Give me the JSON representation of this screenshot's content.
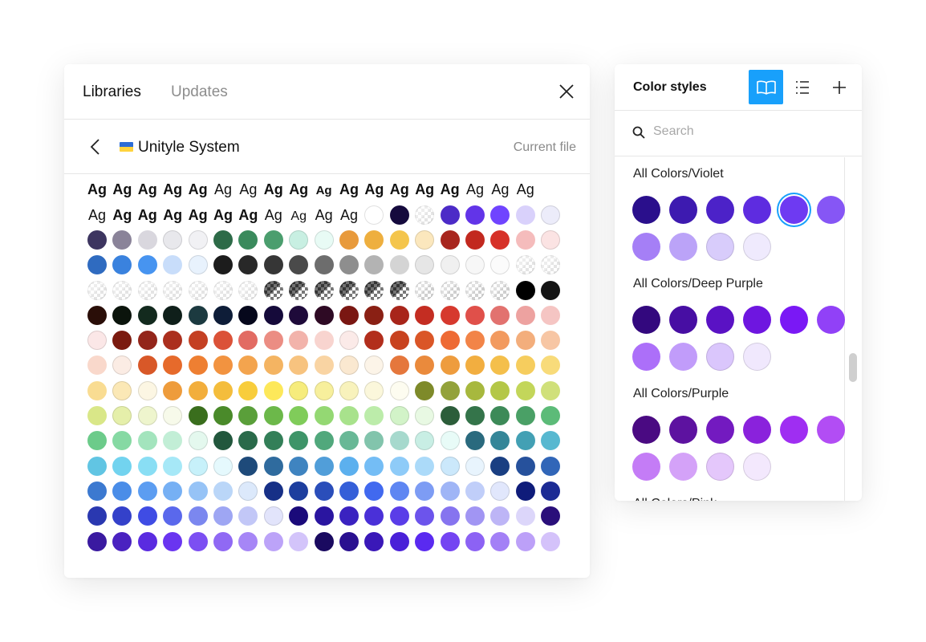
{
  "libraries_panel": {
    "tabs": [
      "Libraries",
      "Updates"
    ],
    "library_name": "Unityle System",
    "current_file_label": "Current file",
    "flag_colors": [
      "#2c6cd6",
      "#ffd33d"
    ],
    "type_sample_text": "Ag",
    "grid_rows": [
      [
        "Ag:b",
        "Ag:b",
        "Ag:b",
        "Ag:b",
        "Ag:b",
        "Ag:m",
        "Ag:m",
        "Ag:r",
        "Ag:r",
        "Ag:r",
        "Ag:b",
        "Ag:b",
        "Ag:b",
        "Ag:b",
        "Ag:r",
        "Ag:r",
        "Ag:b",
        "Ag:b"
      ],
      [
        "Ag:b",
        "Ag:b",
        "Ag:b",
        "Ag:b",
        "Ag:b",
        "Ag:r",
        "Ag:r",
        "Ag:b",
        "Ag:b",
        "Ag:bs",
        "Ag:b",
        "Ag:b",
        "Ag:b",
        "Ag:b",
        "Ag:b",
        "Ag:r",
        "Ag:r",
        "Ag:r"
      ],
      [
        "Ag:r",
        "Ag:b",
        "Ag:b",
        "Ag:b",
        "Ag:b",
        "Ag:b",
        "Ag:b",
        "Ag:r",
        "Ag:rs",
        "Ag:r",
        "Ag:r",
        "#ffffff",
        "#150a3d",
        "chk",
        "#4c2bc7",
        "#6234e8",
        "#7044ff",
        "#d9d1fb",
        "#ececfa"
      ],
      [
        "#3d3560",
        "#8a8399",
        "#d9d7de",
        "#e8e8ec",
        "#f1f1f4",
        "#2d6b48",
        "#3a8a5c",
        "#4b9e6e",
        "#c8efe2",
        "#e8fbf5",
        "#e89a3c",
        "#eeaf3f",
        "#f4c54c",
        "#fbe7bd",
        "#a8261e",
        "#c2291f",
        "#d63128",
        "#f5bcbc",
        "#fbe3e3"
      ],
      [
        "#2f6bc0",
        "#3a82de",
        "#4794f0",
        "#c8ddfa",
        "#e8f2fd",
        "#1c1c1c",
        "#282828",
        "#363636",
        "#4a4a4a",
        "#6d6d6d",
        "#8e8e8e",
        "#b3b3b3",
        "#d4d4d4",
        "#e6e6e6",
        "#f0f0f0",
        "#f7f7f7",
        "#fbfbfb",
        "chk",
        "chk"
      ],
      [
        "chk",
        "chk",
        "chk",
        "chk",
        "chk",
        "chk",
        "chk",
        "chkd",
        "chkd",
        "chkd",
        "chkd",
        "chkd",
        "chkd",
        "chkl",
        "chkl",
        "chkl",
        "chkl",
        "#000000",
        "#141414"
      ],
      [
        "#2a0e08",
        "#0b140c",
        "#132a1e",
        "#0f1f1a",
        "#1c3a40",
        "#0e1d38",
        "#06081c",
        "#150a3a",
        "#1e0a3a",
        "#2e0a24",
        "#7a1712",
        "#8a2014",
        "#a8251a",
        "#c42d22",
        "#d6392e",
        "#e0504a",
        "#e2726f",
        "#eda2a0",
        "#f5c5c3"
      ],
      [
        "#fbe7e7",
        "#7b1a0f",
        "#93251a",
        "#ab2f1e",
        "#c44023",
        "#db5238",
        "#e26b63",
        "#eb8d83",
        "#f2b3ab",
        "#f8d4cf",
        "#fbeae8",
        "#b22e1c",
        "#c8421e",
        "#da5627",
        "#ee6a34",
        "#f28448",
        "#f29a5f",
        "#f3ae7c",
        "#f7c6a4"
      ],
      [
        "#f9d8cb",
        "#fbece4",
        "#d85828",
        "#e66a2b",
        "#ee7f32",
        "#f29340",
        "#f3a44e",
        "#f4b462",
        "#f7c37f",
        "#f9d4a3",
        "#fae8d0",
        "#fcf4e8",
        "#e5773c",
        "#ea8a3c",
        "#ee9c3e",
        "#f2ae40",
        "#f4bf4b",
        "#f6cd5e",
        "#f8db7a"
      ],
      [
        "#f9dc92",
        "#fbe8b6",
        "#fcf6e3",
        "#ee9c3c",
        "#f2ae3c",
        "#f4bd3c",
        "#f8cd3c",
        "#fde85a",
        "#f6ec7c",
        "#f7ef9c",
        "#f8f2bc",
        "#fbf7db",
        "#fdfcf0",
        "#7e8a2a",
        "#93a23a",
        "#a7b83e",
        "#b4c747",
        "#c3d65a",
        "#d0e07a"
      ],
      [
        "#d9e788",
        "#e5efaa",
        "#eef5cd",
        "#f7faea",
        "#3a6e1d",
        "#4a8a2a",
        "#5a9f3a",
        "#6cb84a",
        "#80cc5a",
        "#94d873",
        "#a8e28c",
        "#bcecaa",
        "#d2f3c8",
        "#e8f9e3",
        "#2c5d3a",
        "#34744a",
        "#3d8a58",
        "#4aa066",
        "#5cbb78"
      ],
      [
        "#6ccb8a",
        "#86d9a3",
        "#a3e4bd",
        "#c2eed6",
        "#e4f8ee",
        "#22573d",
        "#2a6a4a",
        "#337f58",
        "#3e9468",
        "#51a87c",
        "#68b896",
        "#82c4ac",
        "#a6d9cd",
        "#c8eee4",
        "#e8fbf7",
        "#2a6a7e",
        "#348698",
        "#43a0b4",
        "#57b8d0"
      ],
      [
        "#61c5e3",
        "#72d3ef",
        "#89def4",
        "#a6e8f7",
        "#c7f1fa",
        "#e5f9fd",
        "#1e4a7a",
        "#2f6b9e",
        "#3f84c0",
        "#519ed9",
        "#5cb0ee",
        "#74bdf5",
        "#8ecbf8",
        "#abdaf9",
        "#cbe8fb",
        "#e8f4fd",
        "#1a3f82",
        "#26519c",
        "#3166b8"
      ],
      [
        "#3c79d0",
        "#4a8de8",
        "#5c9df1",
        "#76b0f4",
        "#96c3f6",
        "#bad6f8",
        "#dce9fb",
        "#173087",
        "#1d3e9e",
        "#2a4eba",
        "#355fd8",
        "#4169ef",
        "#5e86f2",
        "#7d9cf4",
        "#9fb5f6",
        "#c0cef9",
        "#e1e7fc",
        "#0f1c7a",
        "#1c2b94"
      ],
      [
        "#2a38b0",
        "#3441ca",
        "#3f4ce4",
        "#5a68ec",
        "#7b87ef",
        "#9ea6f3",
        "#c2c7f7",
        "#e2e4fb",
        "#1a0a7a",
        "#2a15a0",
        "#3a22c0",
        "#4a30d8",
        "#5a3de8",
        "#6c54ec",
        "#8674ef",
        "#a195f3",
        "#bdb5f6",
        "#dcd6fa",
        "#2a0f7a"
      ],
      [
        "#3a1aa0",
        "#4a22c0",
        "#5a2be0",
        "#6a35f0",
        "#7c4ff2",
        "#9069f4",
        "#a686f6",
        "#bca3f8",
        "#d3c4fa",
        "#1a0a60",
        "#2a1090",
        "#3a18b8",
        "#4a20d8",
        "#5a2af0",
        "#7444f2",
        "#8c62f4",
        "#a380f6",
        "#bca0f8",
        "#d4c2fa"
      ]
    ]
  },
  "color_styles_panel": {
    "title": "Color styles",
    "toolbar_icons": [
      "book-icon",
      "list-icon",
      "plus-icon"
    ],
    "search_placeholder": "Search",
    "groups": [
      {
        "title": "All Colors/Violet",
        "selected_index": 4,
        "swatches": [
          "#2a0f8c",
          "#3d1ab0",
          "#4c22c8",
          "#5e2ce0",
          "#6e3af2",
          "#8656f5",
          "#a57ff6",
          "#bba3f8",
          "#d8ccfb",
          "#efeafd"
        ]
      },
      {
        "title": "All Colors/Deep Purple",
        "swatches": [
          "#33087e",
          "#470ea3",
          "#5a12c4",
          "#6e16e0",
          "#7a18f5",
          "#9141f7",
          "#ac6ff9",
          "#c19cfa",
          "#dac6fc",
          "#f0e8fd"
        ]
      },
      {
        "title": "All Colors/Purple",
        "swatches": [
          "#4a0a82",
          "#5d12a0",
          "#731ac0",
          "#8a22dc",
          "#9f2ef2",
          "#b24df4",
          "#c47cf6",
          "#d4a2f8",
          "#e4c7fb",
          "#f3e8fd"
        ]
      },
      {
        "title": "All Colors/Pink",
        "swatches": []
      }
    ]
  },
  "colors": {
    "accent": "#18a0fb"
  }
}
